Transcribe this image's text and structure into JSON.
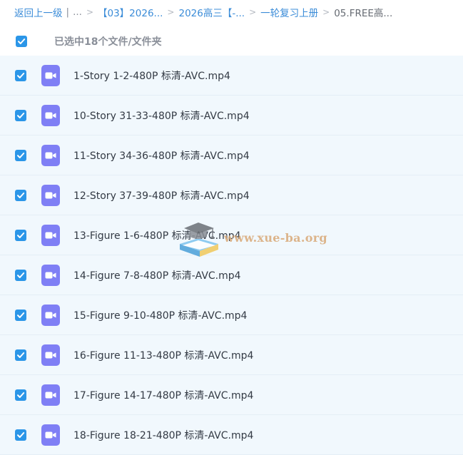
{
  "breadcrumb": {
    "back_label": "返回上一级",
    "separator": "|",
    "ellipsis": "...",
    "arrow": ">",
    "crumb1": "【03】2026...",
    "crumb2": "2026高三【-...",
    "crumb3": "一轮复习上册",
    "current": "05.FREE高..."
  },
  "select_bar": {
    "label": "已选中18个文件/文件夹"
  },
  "files": [
    {
      "name": "1-Story 1-2-480P 标清-AVC.mp4"
    },
    {
      "name": "10-Story 31-33-480P 标清-AVC.mp4"
    },
    {
      "name": "11-Story 34-36-480P 标清-AVC.mp4"
    },
    {
      "name": "12-Story 37-39-480P 标清-AVC.mp4"
    },
    {
      "name": "13-Figure 1-6-480P 标清-AVC.mp4"
    },
    {
      "name": "14-Figure 7-8-480P 标清-AVC.mp4"
    },
    {
      "name": "15-Figure 9-10-480P 标清-AVC.mp4"
    },
    {
      "name": "16-Figure 11-13-480P 标清-AVC.mp4"
    },
    {
      "name": "17-Figure 14-17-480P 标清-AVC.mp4"
    },
    {
      "name": "18-Figure 18-21-480P 标清-AVC.mp4"
    }
  ],
  "watermark": {
    "text": "www.xue-ba.org"
  },
  "colors": {
    "accent": "#2b96e8",
    "link": "#3b8cd8",
    "video_icon": "#7f7ff5",
    "row_bg": "#f1f8fd"
  }
}
